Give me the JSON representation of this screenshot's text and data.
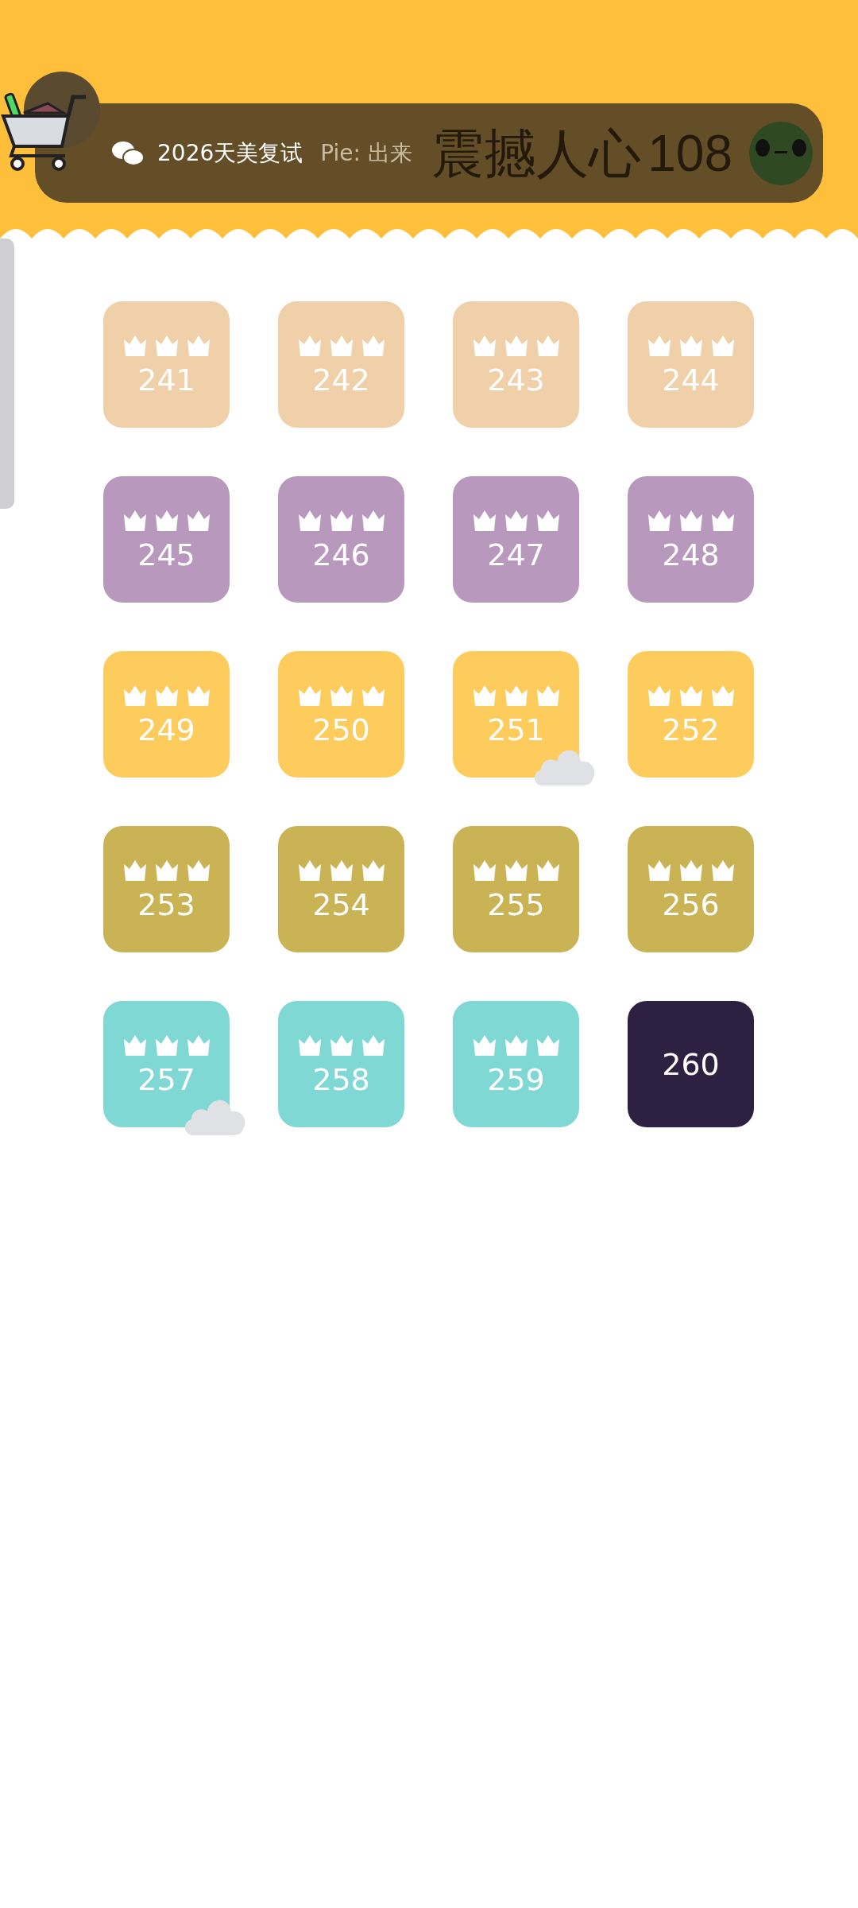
{
  "header": {
    "title": "震撼人心",
    "notification": {
      "text": "2026天美复试",
      "message": "Pie: 出来"
    },
    "score": "108"
  },
  "levels": [
    {
      "label": "241",
      "completed": true,
      "color": "#f0d0a8",
      "cloud": false
    },
    {
      "label": "242",
      "completed": true,
      "color": "#f0d0a8",
      "cloud": false
    },
    {
      "label": "243",
      "completed": true,
      "color": "#f0d0a8",
      "cloud": false
    },
    {
      "label": "244",
      "completed": true,
      "color": "#f0d0a8",
      "cloud": false
    },
    {
      "label": "245",
      "completed": true,
      "color": "#b898bd",
      "cloud": false
    },
    {
      "label": "246",
      "completed": true,
      "color": "#b898bd",
      "cloud": false
    },
    {
      "label": "247",
      "completed": true,
      "color": "#b898bd",
      "cloud": false
    },
    {
      "label": "248",
      "completed": true,
      "color": "#b898bd",
      "cloud": false
    },
    {
      "label": "249",
      "completed": true,
      "color": "#fdcc5c",
      "cloud": false
    },
    {
      "label": "250",
      "completed": true,
      "color": "#fdcc5c",
      "cloud": false
    },
    {
      "label": "251",
      "completed": true,
      "color": "#fdcc5c",
      "cloud": true
    },
    {
      "label": "252",
      "completed": true,
      "color": "#fdcc5c",
      "cloud": false
    },
    {
      "label": "253",
      "completed": true,
      "color": "#c9b355",
      "cloud": false
    },
    {
      "label": "254",
      "completed": true,
      "color": "#c9b355",
      "cloud": false
    },
    {
      "label": "255",
      "completed": true,
      "color": "#c9b355",
      "cloud": false
    },
    {
      "label": "256",
      "completed": true,
      "color": "#c9b355",
      "cloud": false
    },
    {
      "label": "257",
      "completed": true,
      "color": "#80d8d5",
      "cloud": true
    },
    {
      "label": "258",
      "completed": true,
      "color": "#80d8d5",
      "cloud": false
    },
    {
      "label": "259",
      "completed": true,
      "color": "#80d8d5",
      "cloud": false
    },
    {
      "label": "260",
      "completed": false,
      "color": "#2e2040",
      "cloud": false
    }
  ]
}
